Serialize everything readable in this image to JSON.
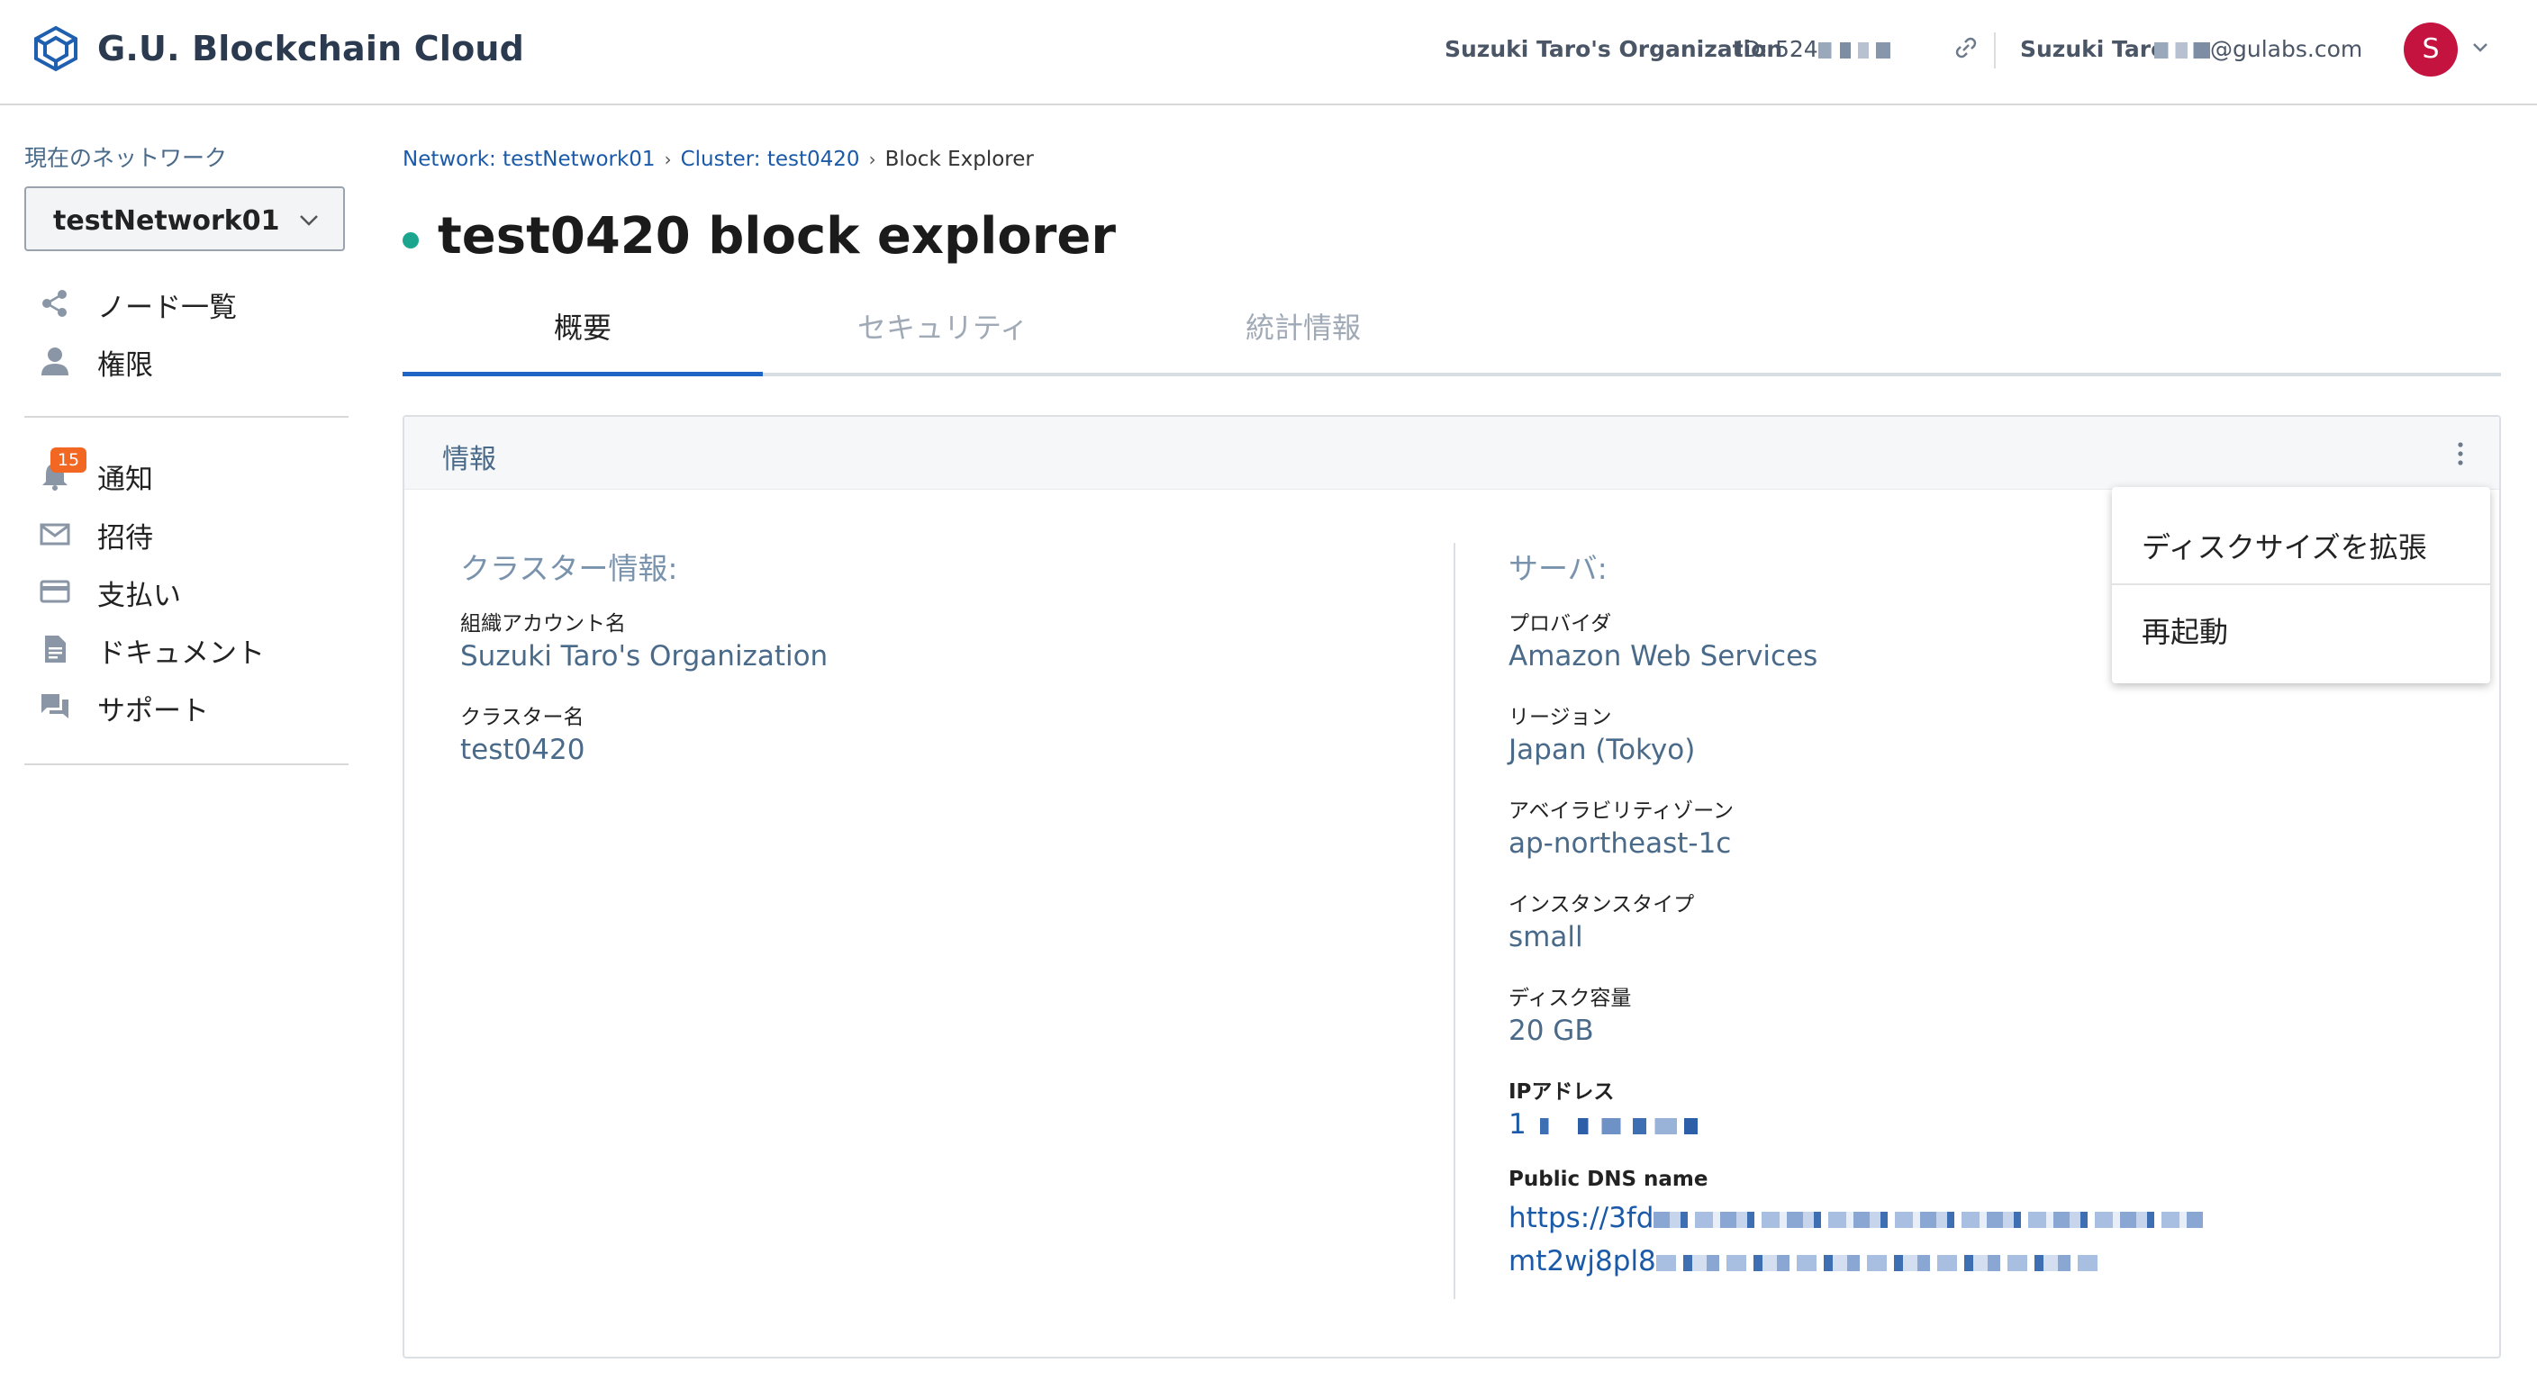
{
  "header": {
    "brand": "G.U. Blockchain Cloud",
    "org_name": "Suzuki Taro's Organization",
    "org_id": "ID: 524",
    "user_name": "Suzuki Taro",
    "user_email": "@gulabs.com",
    "avatar_letter": "S"
  },
  "sidebar": {
    "network_label": "現在のネットワーク",
    "network_value": "testNetwork01",
    "group1": [
      {
        "label": "ノード一覧",
        "icon": "share-icon"
      },
      {
        "label": "権限",
        "icon": "person-icon"
      }
    ],
    "group2": [
      {
        "label": "通知",
        "icon": "bell-icon",
        "badge": "15"
      },
      {
        "label": "招待",
        "icon": "mail-icon"
      },
      {
        "label": "支払い",
        "icon": "credit-card-icon"
      },
      {
        "label": "ドキュメント",
        "icon": "document-icon"
      },
      {
        "label": "サポート",
        "icon": "chat-icon"
      }
    ]
  },
  "breadcrumb": {
    "items": [
      "Network: testNetwork01",
      "Cluster: test0420"
    ],
    "current": "Block Explorer"
  },
  "page": {
    "title": "test0420 block explorer",
    "status_color": "#1ba58f"
  },
  "tabs": [
    {
      "label": "概要",
      "active": true
    },
    {
      "label": "セキュリティ",
      "active": false
    },
    {
      "label": "統計情報",
      "active": false
    }
  ],
  "card": {
    "title": "情報",
    "cluster_section": {
      "title": "クラスター情報:",
      "fields": [
        {
          "label": "組織アカウント名",
          "value": "Suzuki Taro's Organization"
        },
        {
          "label": "クラスター名",
          "value": "test0420"
        }
      ]
    },
    "server_section": {
      "title": "サーバ:",
      "fields": [
        {
          "label": "プロバイダ",
          "value": "Amazon Web Services"
        },
        {
          "label": "リージョン",
          "value": "Japan (Tokyo)"
        },
        {
          "label": "アベイラビリティゾーン",
          "value": "ap-northeast-1c"
        },
        {
          "label": "インスタンスタイプ",
          "value": "small"
        },
        {
          "label": "ディスク容量",
          "value": "20 GB"
        },
        {
          "label": "IPアドレス",
          "value": "1"
        },
        {
          "label": "Public DNS name",
          "value_line1": "https://3fd",
          "value_line2": "mt2wj8pl8"
        }
      ]
    }
  },
  "menu": {
    "items": [
      "ディスクサイズを拡張",
      "再起動"
    ]
  },
  "colors": {
    "accent": "#1f66c4",
    "link": "#1a5aa8",
    "badge": "#f26722",
    "avatar": "#c4133f",
    "status": "#1ba58f"
  }
}
